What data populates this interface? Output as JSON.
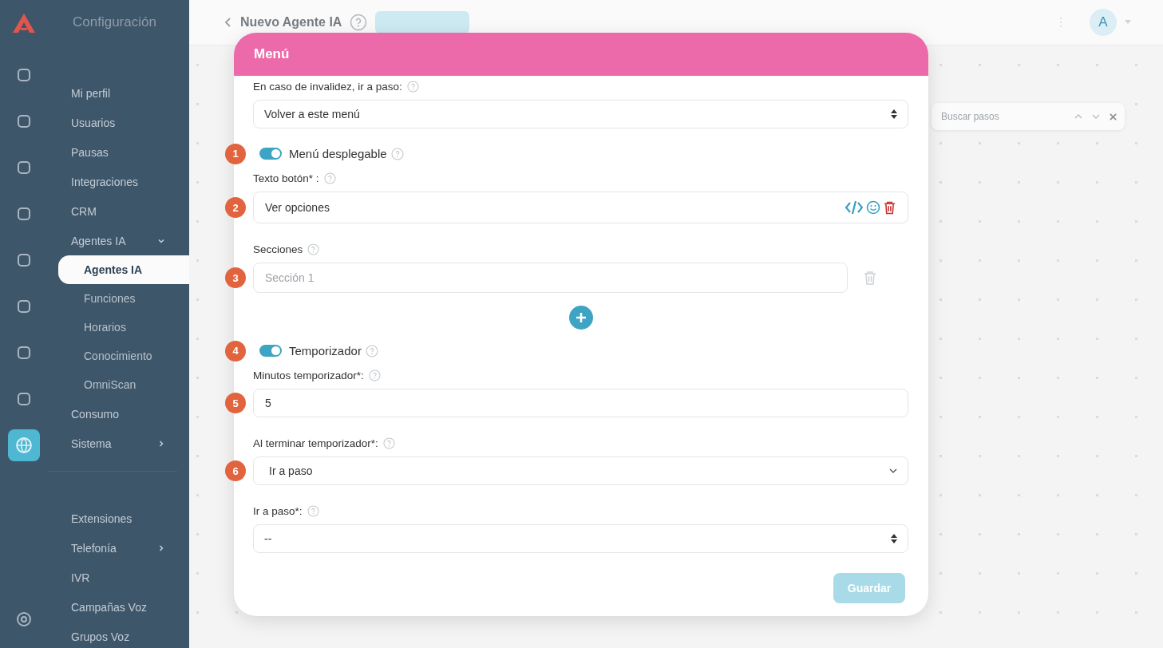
{
  "sidebar": {
    "title": "Configuración",
    "items": [
      {
        "label": "Mi perfil",
        "selected": false
      },
      {
        "label": "Usuarios",
        "selected": false
      },
      {
        "label": "Pausas",
        "selected": false
      },
      {
        "label": "Integraciones",
        "selected": false
      },
      {
        "label": "CRM",
        "selected": false
      },
      {
        "label": "Agentes IA",
        "selected": false,
        "expanded": true,
        "children": [
          {
            "label": "Agentes IA",
            "selected": true
          },
          {
            "label": "Funciones",
            "selected": false
          },
          {
            "label": "Horarios",
            "selected": false
          },
          {
            "label": "Conocimiento",
            "selected": false
          },
          {
            "label": "OmniScan",
            "selected": false
          }
        ]
      },
      {
        "label": "Consumo",
        "selected": false
      },
      {
        "label": "Sistema",
        "selected": false,
        "expanded": false
      },
      {
        "kind": "divider"
      },
      {
        "label": "Extensiones",
        "selected": false
      },
      {
        "label": "Telefonía",
        "selected": false,
        "expanded": false
      },
      {
        "label": "IVR",
        "selected": false
      },
      {
        "label": "Campañas Voz",
        "selected": false
      },
      {
        "label": "Grupos Voz",
        "selected": false
      }
    ]
  },
  "header": {
    "title": "Nuevo Agente IA",
    "avatar": "A"
  },
  "step_search": {
    "placeholder": "Buscar pasos"
  },
  "modal": {
    "title": "Menú",
    "fields": [
      {
        "kind": "select",
        "label": "En caso de invalidez, ir a paso:",
        "value": "Volver a este menú"
      },
      {
        "kind": "toggle",
        "badge": "1",
        "label": "Menú desplegable",
        "on": true
      },
      {
        "kind": "text",
        "label": "Texto botón* :",
        "badge": "2",
        "value": "Ver opciones",
        "tools": true
      },
      {
        "kind": "sections",
        "label": "Secciones",
        "items": [
          {
            "badge": "3",
            "placeholder": "Sección 1"
          }
        ]
      },
      {
        "kind": "add"
      },
      {
        "kind": "toggle",
        "badge": "4",
        "label": "Temporizador",
        "on": true
      },
      {
        "kind": "text",
        "label": "Minutos temporizador*:",
        "badge": "5",
        "value": "5",
        "tools": false
      },
      {
        "kind": "dropdown",
        "label": "Al terminar temporizador*:",
        "badge": "6",
        "value": "Ir a paso"
      },
      {
        "kind": "select",
        "label": "Ir a paso*:",
        "value": "--"
      }
    ],
    "save_button": {
      "label": "Guardar",
      "disabled": true
    }
  }
}
